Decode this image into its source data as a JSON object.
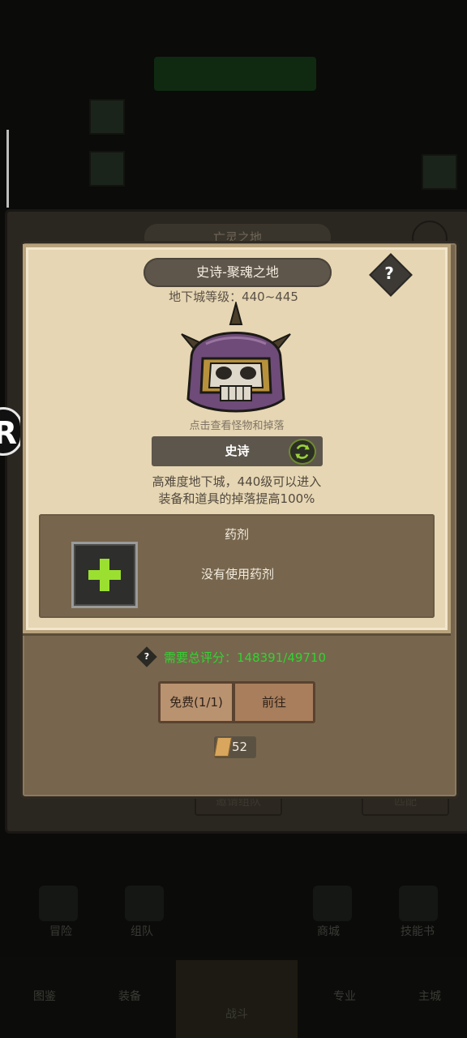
{
  "background": {
    "region_tab": "亡灵之地",
    "nav_row1": [
      "冒险",
      "组队",
      "",
      "商城",
      "技能书"
    ],
    "nav_row2": [
      "图鉴",
      "装备",
      "战斗",
      "专业",
      "主城"
    ],
    "bottom_left_button": "邀请组队",
    "bottom_right_button": "匹配"
  },
  "dialog": {
    "title": "史诗-聚魂之地",
    "help_symbol": "?",
    "dungeon_level": "地下城等级：440~445",
    "hint": "点击查看怪物和掉落",
    "difficulty": "史诗",
    "description_line1": "高难度地下城，440级可以进入",
    "description_line2": "装备和道具的掉落提高100%",
    "potion": {
      "title": "药剂",
      "add_symbol": "+",
      "status": "没有使用药剂"
    },
    "requirement": {
      "icon": "?",
      "text": "需要总评分：148391/49710"
    },
    "free_button": "免费(1/1)",
    "go_button": "前往",
    "ticket_count": "52"
  },
  "colors": {
    "accent_green": "#31d431",
    "parchment": "#e6d6b3",
    "panel_brown": "#77664d"
  },
  "icons": [
    "question-icon",
    "boss-skull-helmet-icon",
    "swap-arrows-icon",
    "plus-icon",
    "ticket-scroll-icon",
    "side-floating-icon"
  ]
}
